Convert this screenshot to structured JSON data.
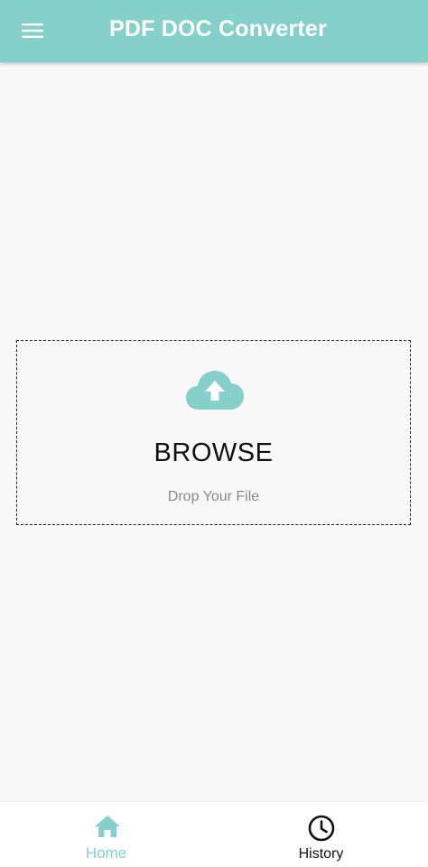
{
  "app_bar": {
    "title": "PDF DOC Converter",
    "menu_icon": "hamburger-menu-icon",
    "background_color": "#85d0cb",
    "title_color": "#ffffff"
  },
  "upload": {
    "icon": "cloud-upload-icon",
    "icon_color": "#85d0cb",
    "browse_label": "BROWSE",
    "hint": "Drop Your File"
  },
  "bottom_nav": {
    "items": [
      {
        "label": "Home",
        "icon": "home-icon",
        "active": true,
        "color": "#85d0cb"
      },
      {
        "label": "History",
        "icon": "clock-icon",
        "active": false,
        "color": "#111111"
      }
    ]
  }
}
